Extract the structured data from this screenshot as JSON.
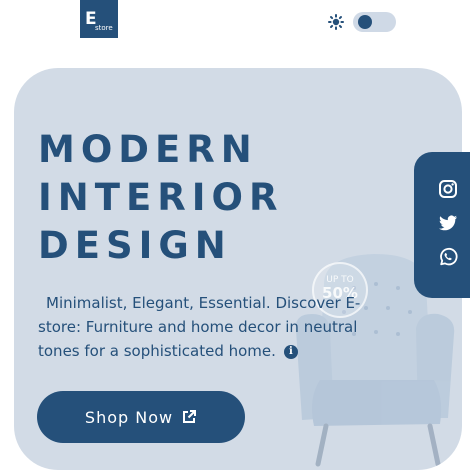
{
  "header": {
    "logo_letter": "E",
    "logo_text": "store",
    "theme_icon": "sun-icon",
    "theme_toggle": "off"
  },
  "hero": {
    "title_lines": [
      "MODERN",
      "INTERIOR",
      "DESIGN"
    ],
    "description": "Minimalist, Elegant, Essential. Discover E-store: Furniture and home decor in neutral tones for a sophisticated home.",
    "info_icon": "info-icon",
    "shop_button_label": "Shop Now",
    "shop_button_icon": "external-link-icon",
    "badge_top": "UP TO",
    "badge_value": "50%"
  },
  "social": [
    "instagram-icon",
    "twitter-icon",
    "whatsapp-icon"
  ],
  "colors": {
    "primary": "#25507a",
    "hero_bg": "#d2dbe6",
    "toggle_bg": "#cfd9e6"
  }
}
